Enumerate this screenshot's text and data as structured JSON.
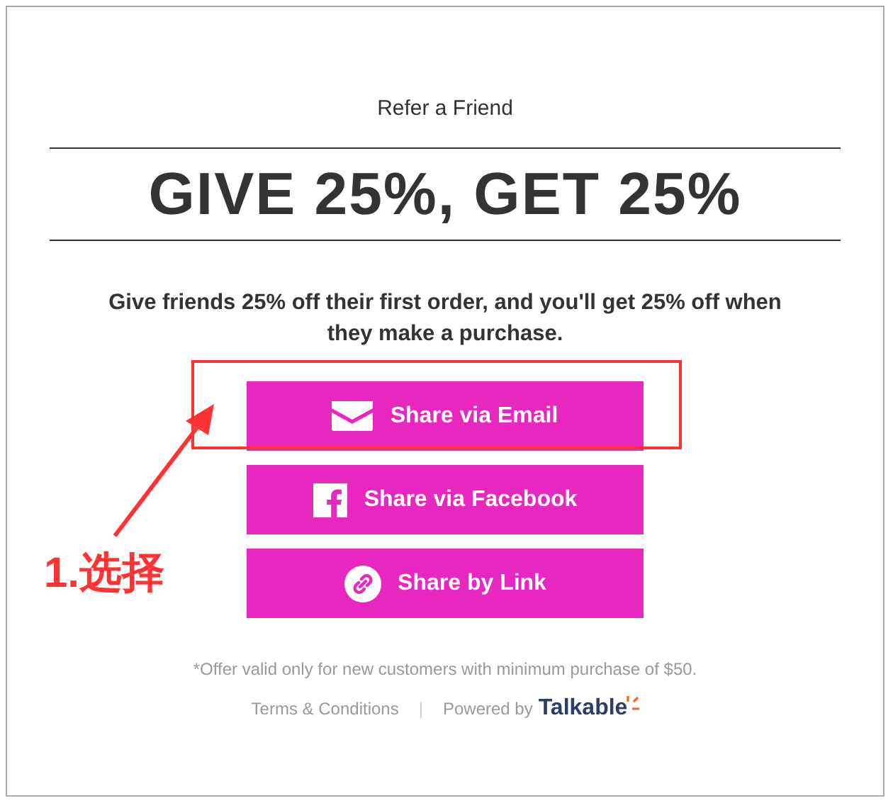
{
  "eyebrow": "Refer a Friend",
  "headline": "GIVE 25%, GET 25%",
  "description": "Give friends 25% off their first order, and you'll get 25% off when they make a purchase.",
  "share_buttons": [
    {
      "kind": "email",
      "label": "Share via Email"
    },
    {
      "kind": "facebook",
      "label": "Share via Facebook"
    },
    {
      "kind": "link",
      "label": "Share by Link"
    }
  ],
  "disclaimer": "*Offer valid only for new customers with minimum purchase of $50.",
  "footer": {
    "terms_link": "Terms & Conditions",
    "separator": "|",
    "powered_by": "Powered by",
    "brand": "Talkable"
  },
  "annotation": {
    "label": "1.选择"
  }
}
